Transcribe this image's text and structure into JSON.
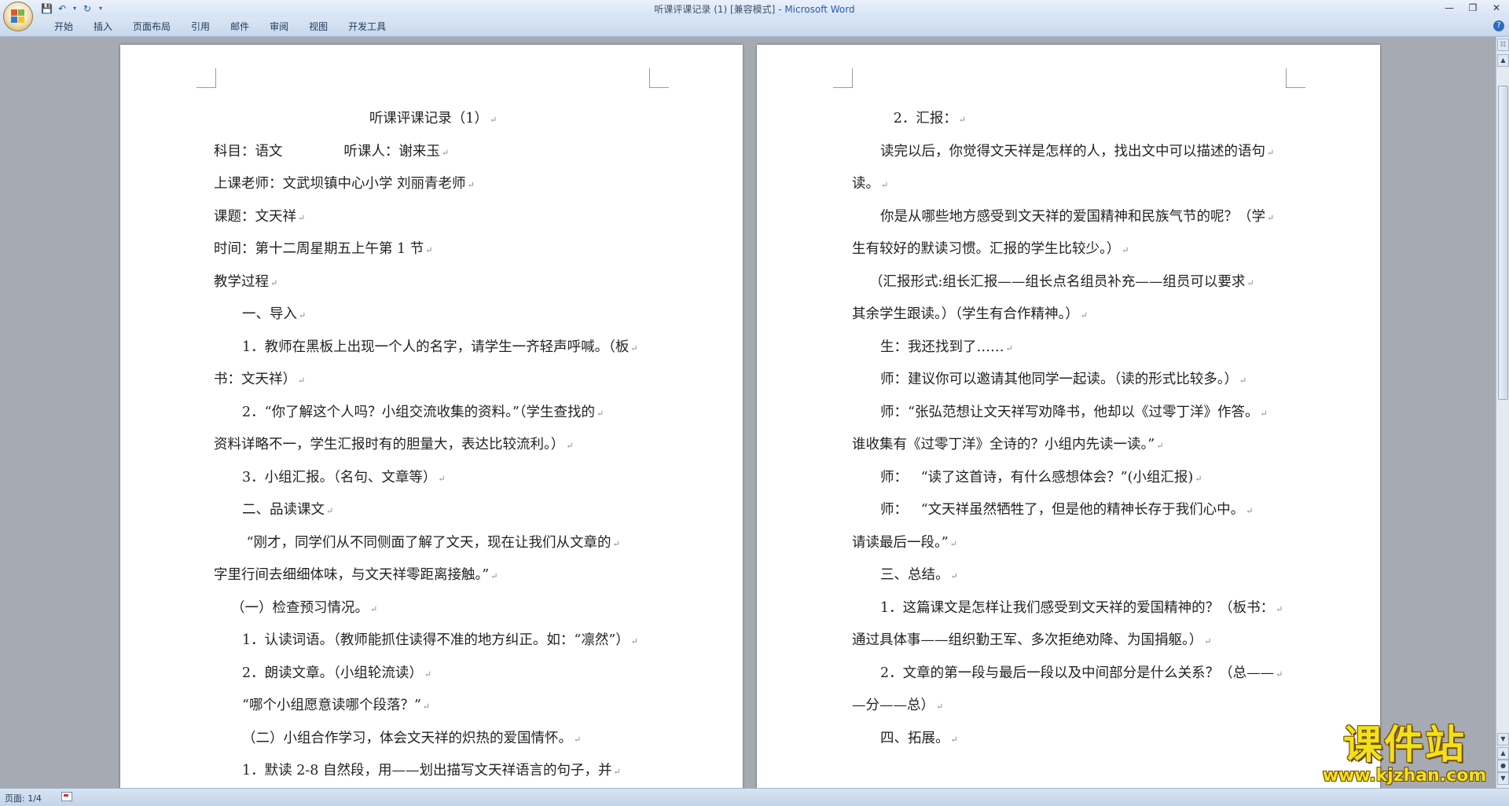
{
  "window": {
    "title_doc": "听课评课记录 (1) [兼容模式] - ",
    "title_app": "Microsoft Word"
  },
  "qat": {
    "save_icon": "save-icon",
    "undo_icon": "undo-icon",
    "redo_icon": "redo-icon",
    "customize_icon": "dropdown-arrow-icon"
  },
  "ribbon": {
    "tabs": [
      "开始",
      "插入",
      "页面布局",
      "引用",
      "邮件",
      "审阅",
      "视图",
      "开发工具"
    ]
  },
  "document": {
    "left_page": [
      {
        "text": "听课评课记录（1）",
        "style": "center"
      },
      {
        "text": "科目：语文              听课人：谢来玉",
        "style": ""
      },
      {
        "text": "上课老师：文武坝镇中心小学 刘丽青老师",
        "style": ""
      },
      {
        "text": "课题：文天祥",
        "style": ""
      },
      {
        "text": "时间：第十二周星期五上午第 1 节",
        "style": ""
      },
      {
        "text": "教学过程",
        "style": ""
      },
      {
        "text": "一、导入",
        "style": "indent"
      },
      {
        "text": "1．教师在黑板上出现一个人的名字，请学生一齐轻声呼喊。（板",
        "style": "indent"
      },
      {
        "text": "书：文天祥）",
        "style": ""
      },
      {
        "text": "2．“你了解这个人吗？小组交流收集的资料。”（学生查找的",
        "style": "indent"
      },
      {
        "text": "资料详略不一，学生汇报时有的胆量大，表达比较流利。）",
        "style": ""
      },
      {
        "text": "3．小组汇报。（名句、文章等）",
        "style": "indent"
      },
      {
        "text": "二、品读课文",
        "style": "indent"
      },
      {
        "text": " “刚才，同学们从不同侧面了解了文天，现在让我们从文章的",
        "style": "indent"
      },
      {
        "text": "字里行间去细细体味，与文天祥零距离接触。”",
        "style": ""
      },
      {
        "text": "（一）检查预习情况。",
        "style": "indent-small"
      },
      {
        "text": "1．认读词语。（教师能抓住读得不准的地方纠正。如：“凛然”）",
        "style": "indent"
      },
      {
        "text": "2．朗读文章。（小组轮流读）",
        "style": "indent"
      },
      {
        "text": "“哪个小组愿意读哪个段落？”",
        "style": "indent"
      },
      {
        "text": "（二）小组合作学习，体会文天祥的炽热的爱国情怀。",
        "style": "indent"
      },
      {
        "text": "1．默读 2-8 自然段，用——划出描写文天祥语言的句子，并",
        "style": "indent"
      }
    ],
    "right_page": [
      {
        "text": "   2．汇报：",
        "style": "indent"
      },
      {
        "text": "读完以后，你觉得文天祥是怎样的人，找出文中可以描述的语句",
        "style": "indent"
      },
      {
        "text": "读。",
        "style": ""
      },
      {
        "text": "你是从哪些地方感受到文天祥的爱国精神和民族气节的呢？（学",
        "style": "indent"
      },
      {
        "text": "生有较好的默读习惯。汇报的学生比较少。）",
        "style": ""
      },
      {
        "text": "（汇报形式:组长汇报——组长点名组员补充——组员可以要求",
        "style": "indent-small"
      },
      {
        "text": "其余学生跟读。）（学生有合作精神。）",
        "style": ""
      },
      {
        "text": "生：我还找到了……",
        "style": "indent"
      },
      {
        "text": "师：建议你可以邀请其他同学一起读。（读的形式比较多。）",
        "style": "indent"
      },
      {
        "text": "师：“张弘范想让文天祥写劝降书，他却以《过零丁洋》作答。",
        "style": "indent"
      },
      {
        "text": "谁收集有《过零丁洋》全诗的？小组内先读一读。”",
        "style": ""
      },
      {
        "text": "师：   “读了这首诗，有什么感想体会？”(小组汇报)",
        "style": "indent"
      },
      {
        "text": "师：   “文天祥虽然牺牲了，但是他的精神长存于我们心中。",
        "style": "indent"
      },
      {
        "text": "请读最后一段。”",
        "style": ""
      },
      {
        "text": "三、总结。",
        "style": "indent"
      },
      {
        "text": "1．这篇课文是怎样让我们感受到文天祥的爱国精神的？（板书：",
        "style": "indent"
      },
      {
        "text": "通过具体事——组织勤王军、多次拒绝劝降、为国捐躯。）",
        "style": ""
      },
      {
        "text": "2．文章的第一段与最后一段以及中间部分是什么关系？（总——",
        "style": "indent"
      },
      {
        "text": "—分——总）",
        "style": ""
      },
      {
        "text": "四、拓展。",
        "style": "indent"
      }
    ]
  },
  "statusbar": {
    "page_label": "页面: 1/4"
  },
  "watermark": {
    "title": "课件站",
    "url": "www.kjzhan.com"
  }
}
